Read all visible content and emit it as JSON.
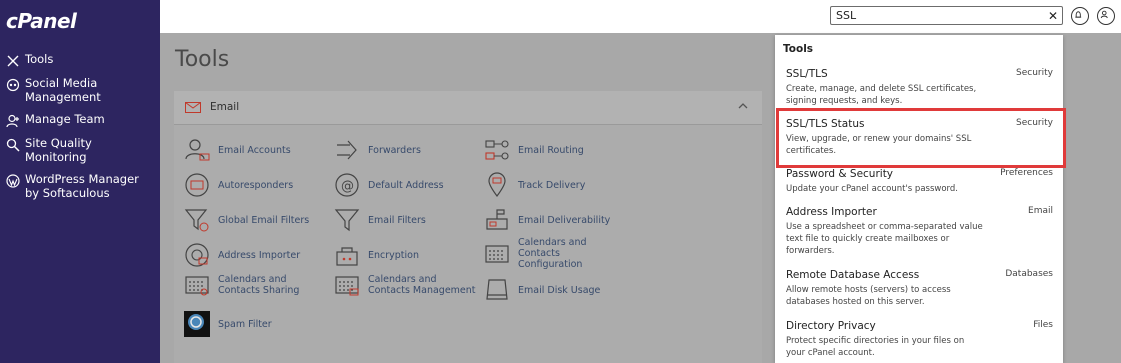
{
  "brand": "cPanel",
  "sidebar": {
    "items": [
      {
        "label": "Tools",
        "icon": "tools-icon"
      },
      {
        "label": "Social Media Management",
        "icon": "social-media-icon"
      },
      {
        "label": "Manage Team",
        "icon": "manage-team-icon"
      },
      {
        "label": "Site Quality Monitoring",
        "icon": "site-quality-icon"
      },
      {
        "label": "WordPress Manager by Softaculous",
        "icon": "wordpress-icon"
      }
    ]
  },
  "header": {
    "search_value": "SSL",
    "clear_icon": "close-icon",
    "bell_icon": "bell-icon",
    "user_icon": "user-icon"
  },
  "main": {
    "title": "Tools",
    "email_panel": {
      "title": "Email",
      "tools": [
        {
          "label": "Email Accounts",
          "icon": "email-accounts-icon"
        },
        {
          "label": "Forwarders",
          "icon": "forwarders-icon"
        },
        {
          "label": "Email Routing",
          "icon": "email-routing-icon"
        },
        {
          "label": "Autoresponders",
          "icon": "autoresponders-icon"
        },
        {
          "label": "Default Address",
          "icon": "default-address-icon"
        },
        {
          "label": "Track Delivery",
          "icon": "track-delivery-icon"
        },
        {
          "label": "Global Email Filters",
          "icon": "global-email-filters-icon"
        },
        {
          "label": "Email Filters",
          "icon": "email-filters-icon"
        },
        {
          "label": "Email Deliverability",
          "icon": "email-deliverability-icon"
        },
        {
          "label": "Address Importer",
          "icon": "address-importer-icon"
        },
        {
          "label": "Encryption",
          "icon": "encryption-icon"
        },
        {
          "label": "Calendars and Contacts Configuration",
          "icon": "calendars-config-icon"
        },
        {
          "label": "Calendars and Contacts Sharing",
          "icon": "calendars-sharing-icon"
        },
        {
          "label": "Calendars and Contacts Management",
          "icon": "calendars-management-icon"
        },
        {
          "label": "Email Disk Usage",
          "icon": "email-disk-usage-icon"
        },
        {
          "label": "Spam Filter",
          "icon": "spam-filter-icon"
        }
      ]
    }
  },
  "dropdown": {
    "heading": "Tools",
    "results": [
      {
        "name": "SSL/TLS",
        "category": "Security",
        "description": "Create, manage, and delete SSL certificates, signing requests, and keys."
      },
      {
        "name": "SSL/TLS Status",
        "category": "Security",
        "description": "View, upgrade, or renew your domains' SSL certificates."
      },
      {
        "name": "Password & Security",
        "category": "Preferences",
        "description": "Update your cPanel account's password."
      },
      {
        "name": "Address Importer",
        "category": "Email",
        "description": "Use a spreadsheet or comma-separated value text file to quickly create mailboxes or forwarders."
      },
      {
        "name": "Remote Database Access",
        "category": "Databases",
        "description": "Allow remote hosts (servers) to access databases hosted on this server."
      },
      {
        "name": "Directory Privacy",
        "category": "Files",
        "description": "Protect specific directories in your files on your cPanel account."
      }
    ]
  },
  "colors": {
    "sidebar_bg": "#2d2560",
    "highlight_border": "#e03a3a",
    "link_text": "#374a6b"
  }
}
